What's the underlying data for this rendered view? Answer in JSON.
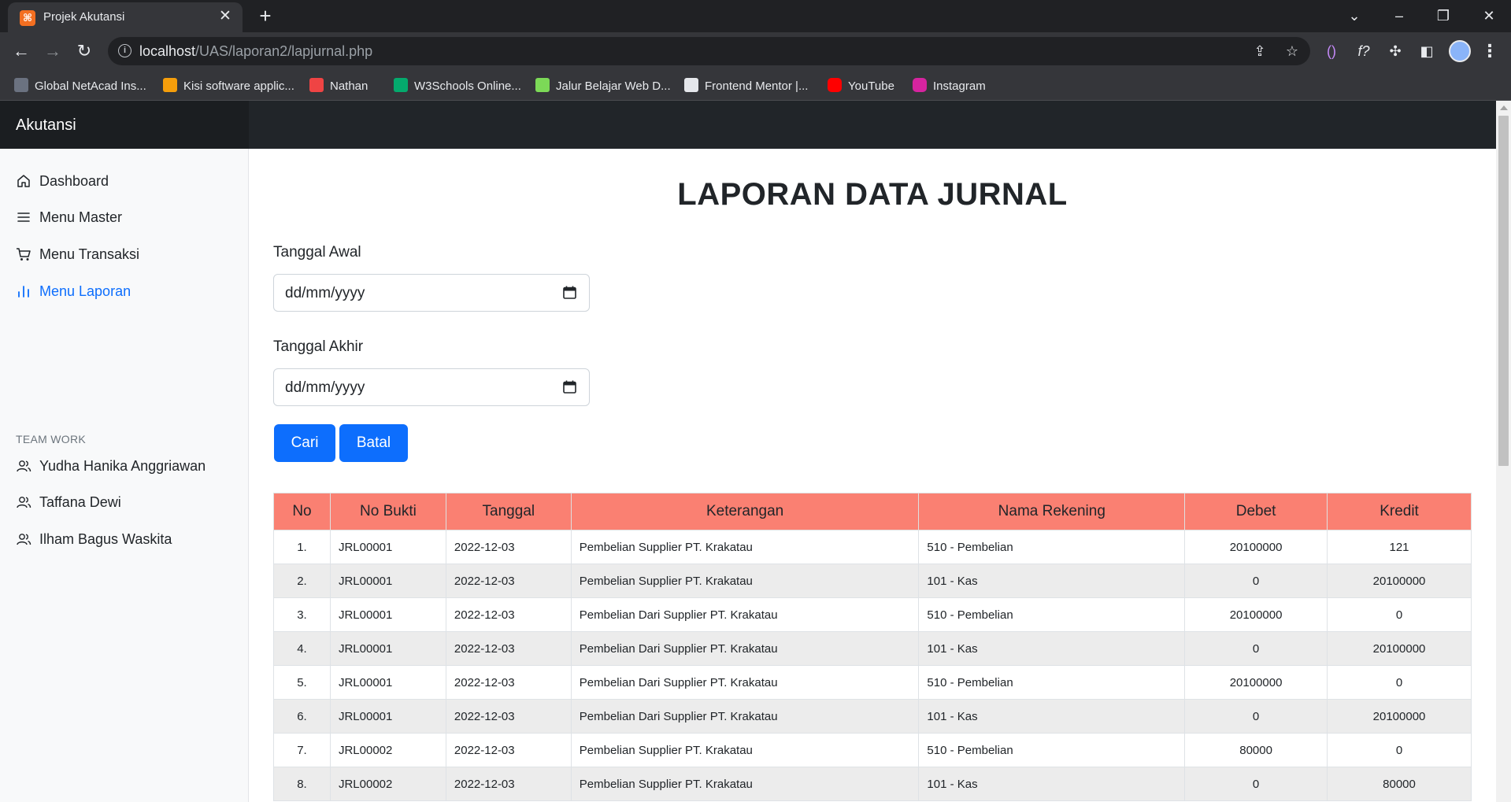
{
  "browser": {
    "tab_title": "Projek Akutansi",
    "url_host": "localhost",
    "url_path": "/UAS/laporan2/lapjurnal.php",
    "bookmarks": [
      "Global NetAcad Ins...",
      "Kisi software applic...",
      "Nathan",
      "W3Schools Online...",
      "Jalur Belajar Web D...",
      "Frontend Mentor |...",
      "YouTube",
      "Instagram"
    ]
  },
  "app": {
    "brand": "Akutansi"
  },
  "sidebar": {
    "items": [
      {
        "label": "Dashboard",
        "icon": "home-icon"
      },
      {
        "label": "Menu Master",
        "icon": "menu-icon"
      },
      {
        "label": "Menu Transaksi",
        "icon": "cart-icon"
      },
      {
        "label": "Menu Laporan",
        "icon": "bar-chart-icon",
        "active": true
      }
    ],
    "team_heading": "TEAM WORK",
    "team": [
      {
        "label": "Yudha Hanika Anggriawan",
        "icon": "users-icon"
      },
      {
        "label": "Taffana Dewi",
        "icon": "users-icon"
      },
      {
        "label": "Ilham Bagus Waskita",
        "icon": "users-icon"
      }
    ]
  },
  "report": {
    "title": "LAPORAN DATA JURNAL",
    "start_label": "Tanggal Awal",
    "start_value": "dd/mm/yyyy",
    "end_label": "Tanggal Akhir",
    "end_value": "dd/mm/yyyy",
    "search_button": "Cari",
    "cancel_button": "Batal"
  },
  "table": {
    "header_color": "#fa8072",
    "headers": [
      "No",
      "No Bukti",
      "Tanggal",
      "Keterangan",
      "Nama Rekening",
      "Debet",
      "Kredit"
    ],
    "rows": [
      [
        "1.",
        "JRL00001",
        "2022-12-03",
        "Pembelian Supplier PT. Krakatau",
        "510 - Pembelian",
        "20100000",
        "121"
      ],
      [
        "2.",
        "JRL00001",
        "2022-12-03",
        "Pembelian Supplier PT. Krakatau",
        "101 - Kas",
        "0",
        "20100000"
      ],
      [
        "3.",
        "JRL00001",
        "2022-12-03",
        "Pembelian Dari Supplier PT. Krakatau",
        "510 - Pembelian",
        "20100000",
        "0"
      ],
      [
        "4.",
        "JRL00001",
        "2022-12-03",
        "Pembelian Dari Supplier PT. Krakatau",
        "101 - Kas",
        "0",
        "20100000"
      ],
      [
        "5.",
        "JRL00001",
        "2022-12-03",
        "Pembelian Dari Supplier PT. Krakatau",
        "510 - Pembelian",
        "20100000",
        "0"
      ],
      [
        "6.",
        "JRL00001",
        "2022-12-03",
        "Pembelian Dari Supplier PT. Krakatau",
        "101 - Kas",
        "0",
        "20100000"
      ],
      [
        "7.",
        "JRL00002",
        "2022-12-03",
        "Pembelian Supplier PT. Krakatau",
        "510 - Pembelian",
        "80000",
        "0"
      ],
      [
        "8.",
        "JRL00002",
        "2022-12-03",
        "Pembelian Supplier PT. Krakatau",
        "101 - Kas",
        "0",
        "80000"
      ]
    ]
  },
  "colors": {
    "primary": "#0d6efd",
    "topbar": "#212529",
    "active_link": "#0d6efd"
  }
}
